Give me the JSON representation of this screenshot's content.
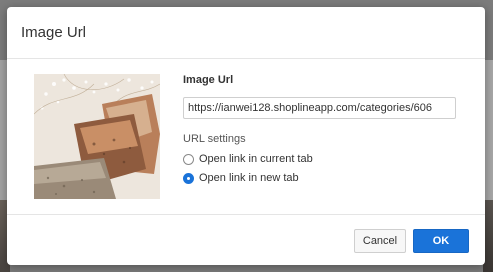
{
  "dialog": {
    "title": "Image Url"
  },
  "form": {
    "image_url_label": "Image Url",
    "image_url_value": "https://ianwei128.shoplineapp.com/categories/606",
    "url_settings_label": "URL settings",
    "options": [
      {
        "label": "Open link in current tab",
        "checked": false
      },
      {
        "label": "Open link in new tab",
        "checked": true
      }
    ]
  },
  "footer": {
    "cancel_label": "Cancel",
    "ok_label": "OK"
  },
  "colors": {
    "primary": "#1a73d9",
    "backdrop": "#7c7c7c"
  }
}
